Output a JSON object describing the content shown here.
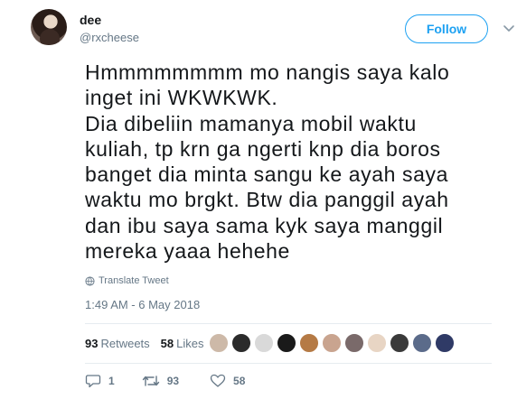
{
  "user": {
    "name": "dee",
    "handle": "@rxcheese",
    "follow_label": "Follow"
  },
  "tweet": {
    "text": "Hmmmmmmmm mo nangis saya kalo\ninget ini WKWKWK.\nDia dibeliin mamanya mobil waktu\nkuliah, tp krn ga ngerti knp dia boros\nbanget dia minta sangu ke ayah saya\nwaktu mo brgkt. Btw dia panggil ayah\ndan ibu saya sama kyk saya manggil\nmereka yaaa hehehe",
    "translate_label": "Translate Tweet",
    "timestamp": "1:49 AM - 6 May 2018"
  },
  "stats": {
    "retweets_count": "93",
    "retweets_label": "Retweets",
    "likes_count": "58",
    "likes_label": "Likes"
  },
  "likers": {
    "colors": [
      "#cdb9a8",
      "#2b2b2b",
      "#d9d9d9",
      "#1a1a1a",
      "#b57a45",
      "#c9a48f",
      "#7a6a6a",
      "#e8d5c4",
      "#3a3a3a",
      "#5b6b8a",
      "#2f3a66"
    ]
  },
  "actions": {
    "replies": "1",
    "retweets": "93",
    "likes": "58"
  },
  "colors": {
    "accent": "#1da1f2",
    "secondary_text": "#657786",
    "divider": "#e6ecf0"
  }
}
